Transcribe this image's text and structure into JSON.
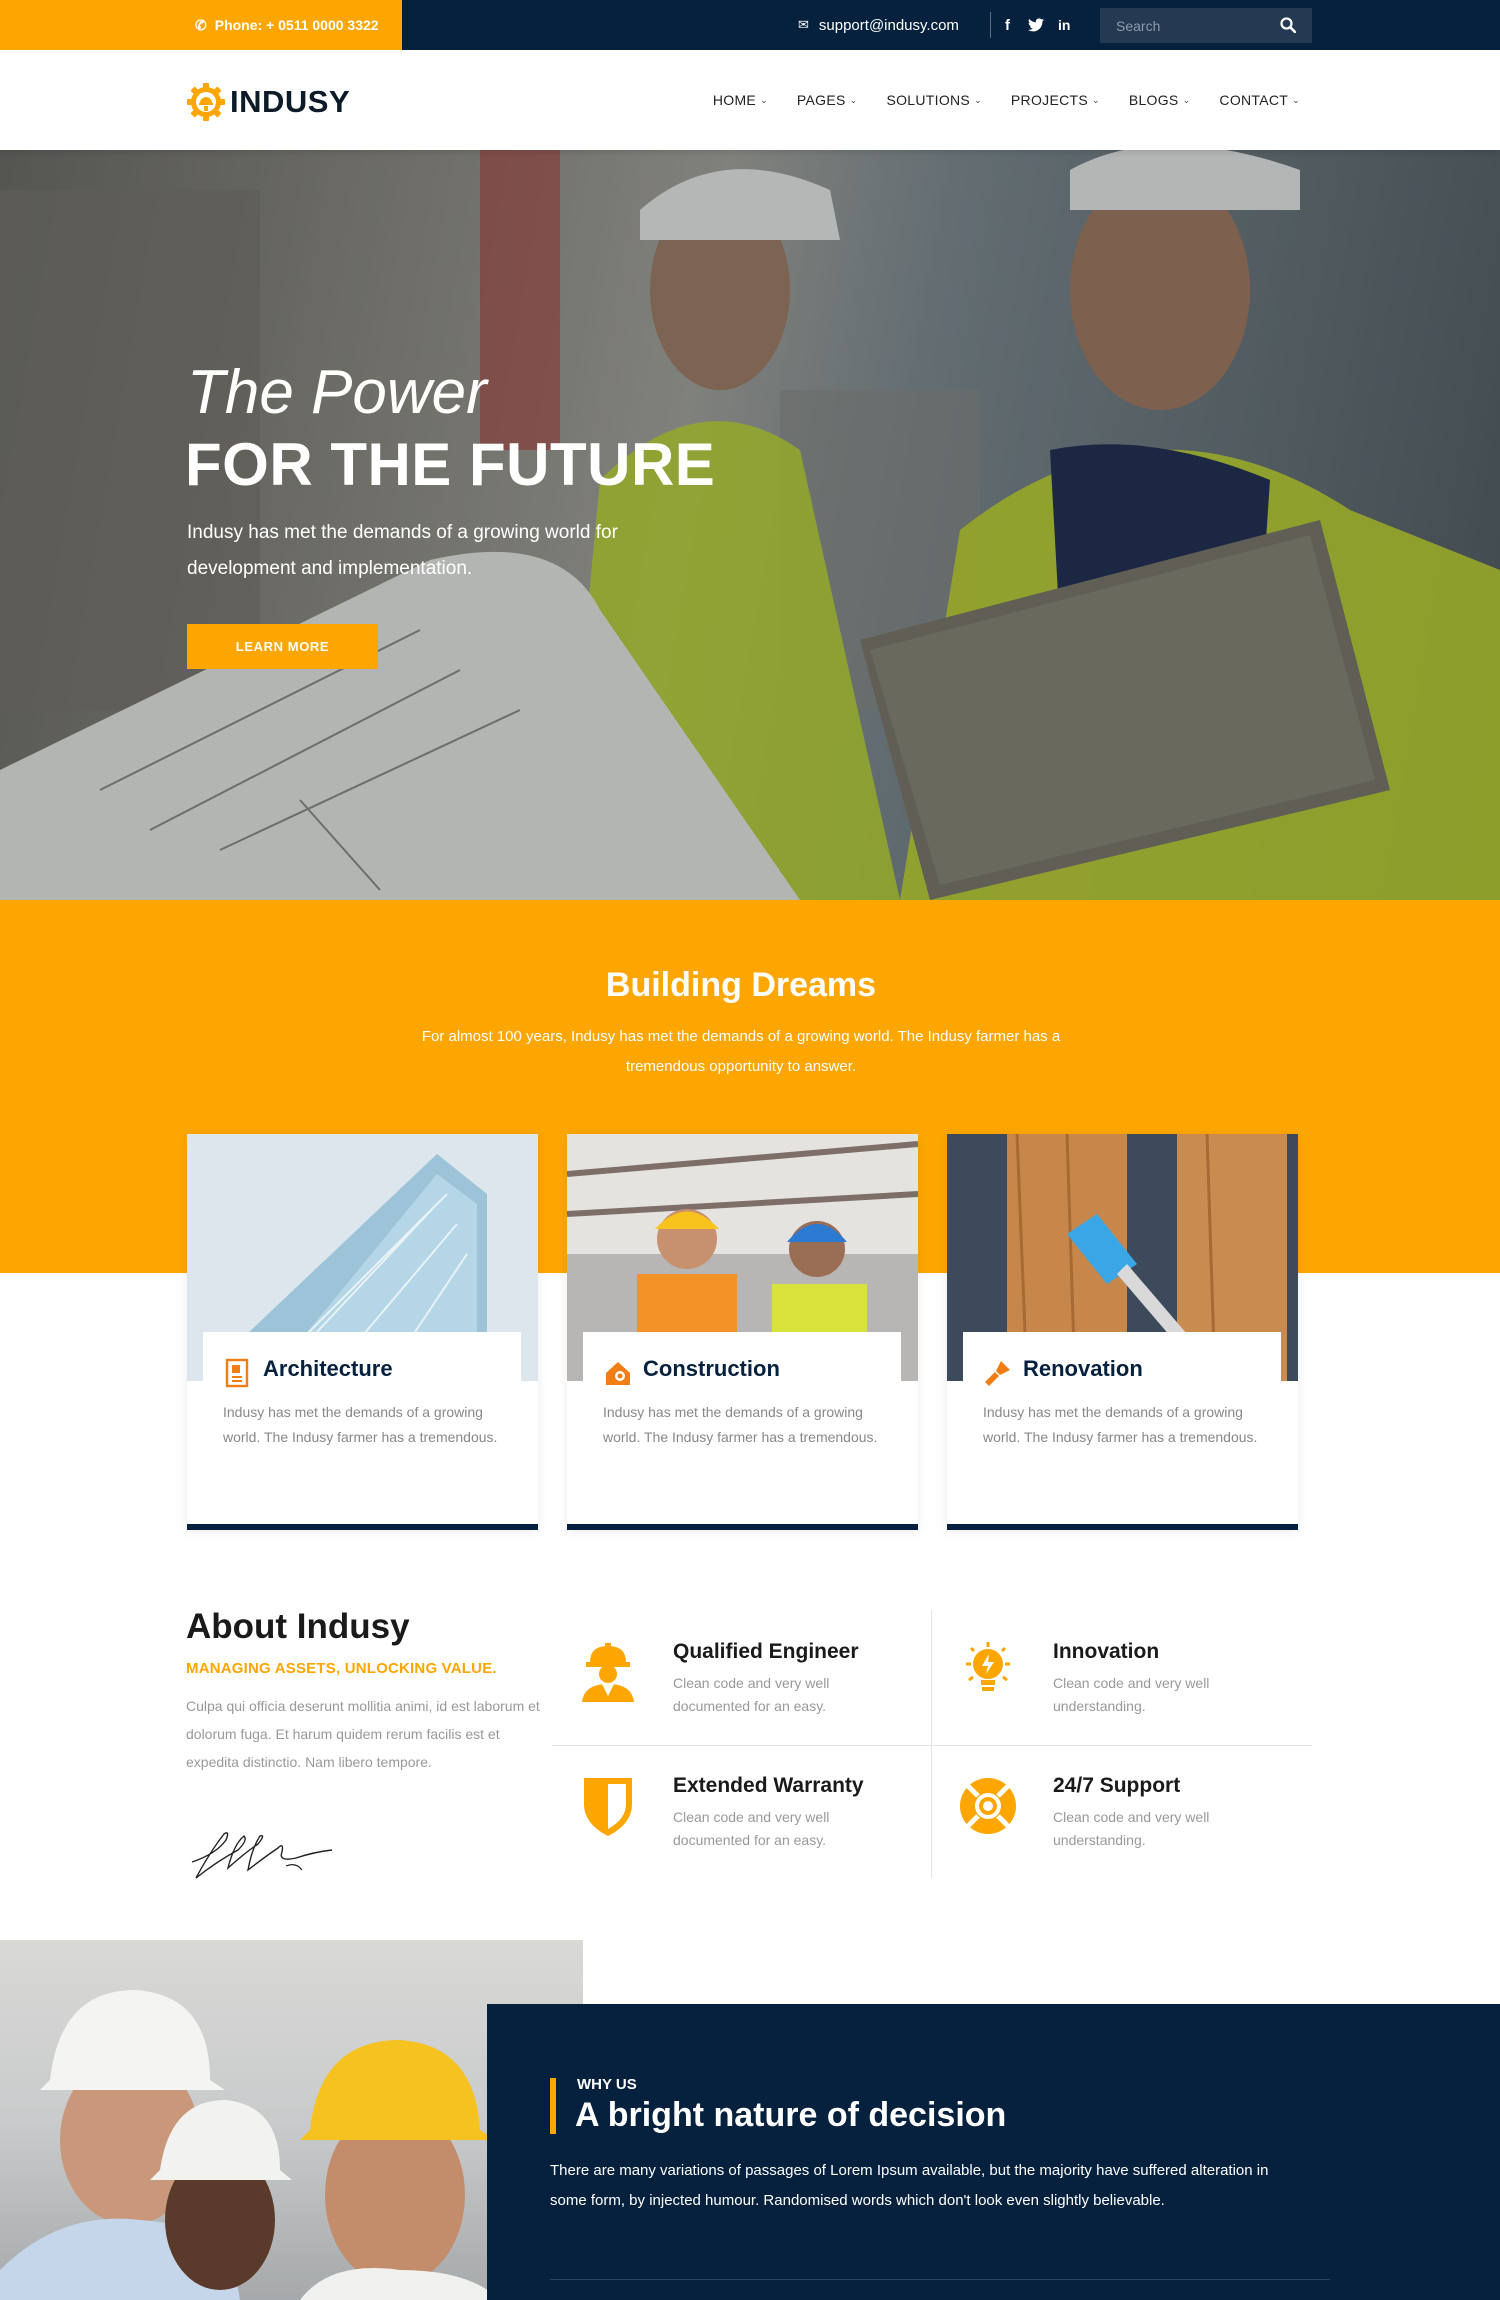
{
  "topbar": {
    "phone": "Phone: + 0511 0000 3322",
    "email": "support@indusy.com",
    "social": [
      "facebook-icon",
      "twitter-icon",
      "linkedin-icon"
    ],
    "search_placeholder": "Search"
  },
  "header": {
    "logo": "INDUSY",
    "nav": [
      {
        "label": "HOME"
      },
      {
        "label": "PAGES"
      },
      {
        "label": "SOLUTIONS"
      },
      {
        "label": "PROJECTS"
      },
      {
        "label": "BLOGS"
      },
      {
        "label": "CONTACT"
      }
    ]
  },
  "hero": {
    "title_line1": "The Power",
    "title_line2": "FOR THE FUTURE",
    "description": "Indusy has met the demands of a growing world for development and implementation.",
    "button": "LEARN MORE"
  },
  "dreams": {
    "title": "Building Dreams",
    "text": "For almost 100 years, Indusy has met the demands of a growing world. The Indusy farmer has a tremendous opportunity to answer.",
    "cards": [
      {
        "title": "Architecture",
        "text": "Indusy has met the demands of a growing world. The Indusy farmer has a tremendous."
      },
      {
        "title": "Construction",
        "text": "Indusy has met the demands of a growing world. The Indusy farmer has a tremendous."
      },
      {
        "title": "Renovation",
        "text": "Indusy has met the demands of a growing world. The Indusy farmer has a tremendous."
      }
    ]
  },
  "about": {
    "title": "About Indusy",
    "subtitle": "MANAGING ASSETS, UNLOCKING VALUE.",
    "text": "Culpa qui officia deserunt mollitia animi, id est laborum et dolorum fuga. Et harum quidem rerum facilis est et expedita distinctio. Nam libero tempore.",
    "features": [
      {
        "title": "Qualified Engineer",
        "text": "Clean code and very well documented for an easy."
      },
      {
        "title": "Innovation",
        "text": "Clean code and very well understanding."
      },
      {
        "title": "Extended Warranty",
        "text": "Clean code and very well documented for an easy."
      },
      {
        "title": "24/7 Support",
        "text": "Clean code and very well understanding."
      }
    ]
  },
  "why": {
    "label": "WHY US",
    "title": "A bright nature of decision",
    "text": "There are many variations of passages of Lorem Ipsum available, but the majority have suffered alteration in some form, by injected humour. Randomised words which don't look even slightly believable."
  },
  "colors": {
    "accent": "#fda600",
    "navy": "#06213d"
  }
}
